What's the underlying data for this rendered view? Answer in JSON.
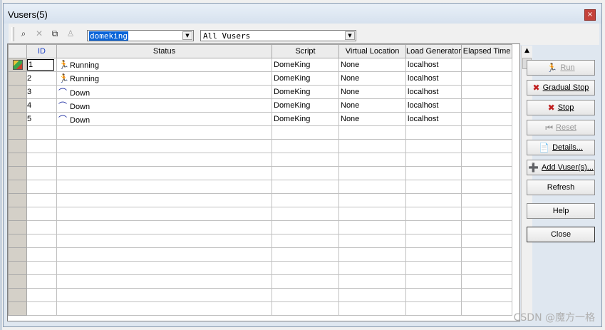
{
  "window": {
    "title": "Vusers(5)",
    "close_glyph": "×"
  },
  "toolbar": {
    "icons": [
      "find-vuser-icon",
      "clear-icon",
      "copy-icon",
      "disabled-vuser-icon"
    ],
    "group_combo_value": "domeking",
    "filter_combo_value": "All Vusers",
    "combo_arrow": "▼"
  },
  "grid": {
    "columns": [
      "",
      "ID",
      "Status",
      "Script",
      "Virtual Location",
      "Load Generator",
      "Elapsed Time"
    ],
    "rows": [
      {
        "id": "1",
        "status": "Running",
        "status_icon": "running-man-icon",
        "status_glyph": "🏃",
        "script": "DomeKing",
        "location": "None",
        "generator": "localhost",
        "elapsed": ""
      },
      {
        "id": "2",
        "status": "Running",
        "status_icon": "running-man-icon",
        "status_glyph": "🏃",
        "script": "DomeKing",
        "location": "None",
        "generator": "localhost",
        "elapsed": ""
      },
      {
        "id": "3",
        "status": "Down",
        "status_icon": "down-man-icon",
        "status_glyph": "⌒",
        "script": "DomeKing",
        "location": "None",
        "generator": "localhost",
        "elapsed": ""
      },
      {
        "id": "4",
        "status": "Down",
        "status_icon": "down-man-icon",
        "status_glyph": "⌒",
        "script": "DomeKing",
        "location": "None",
        "generator": "localhost",
        "elapsed": ""
      },
      {
        "id": "5",
        "status": "Down",
        "status_icon": "down-man-icon",
        "status_glyph": "⌒",
        "script": "DomeKing",
        "location": "None",
        "generator": "localhost",
        "elapsed": ""
      }
    ]
  },
  "buttons": {
    "run": "Run",
    "gradual_stop": "Gradual Stop",
    "stop": "Stop",
    "reset": "Reset",
    "details": "Details...",
    "add_vusers": "Add Vuser(s)...",
    "refresh": "Refresh",
    "help": "Help",
    "close": "Close"
  },
  "watermark": "CSDN @魔方一格"
}
